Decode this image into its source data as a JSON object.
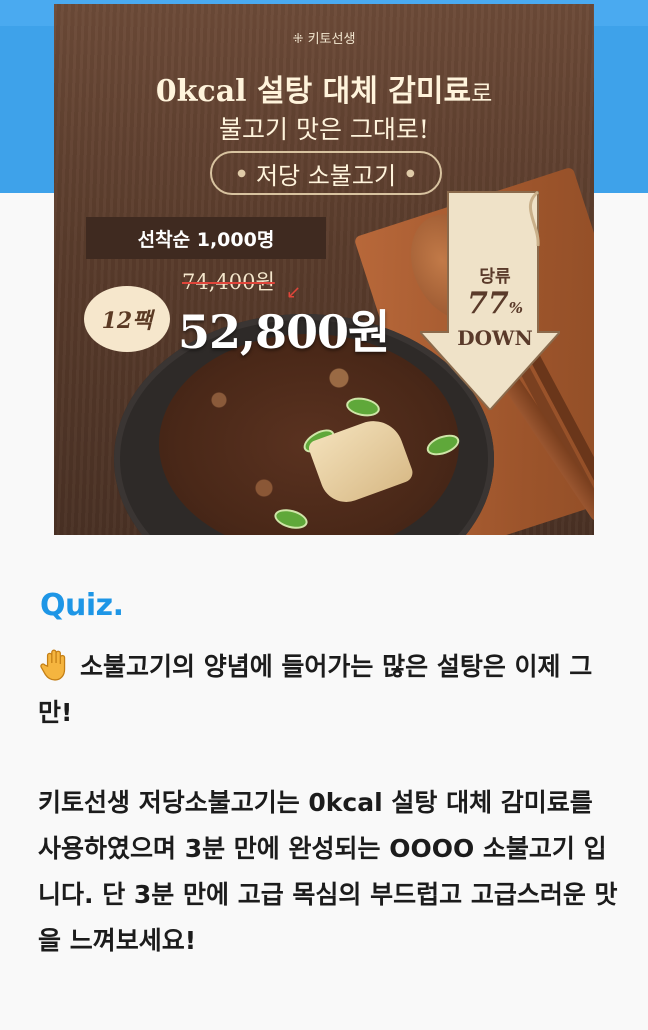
{
  "colors": {
    "accent_blue": "#3ea2ea",
    "quiz_title": "#1e96e6",
    "body_text": "#1c1c1c",
    "banner_brown": "#5a3c2c"
  },
  "banner": {
    "brand": "키토선생",
    "headline_main": "0kcal 설탕 대체 감미료",
    "headline_suffix": "로",
    "subline": "불고기 맛은 그대로!",
    "product_name": "저당 소불고기",
    "first_come": "선착순 1,000명",
    "pack_count": "12팩",
    "original_price": "74,400원",
    "sale_price": "52,800원",
    "sugar_label": "당류",
    "sugar_percent": "77",
    "percent_sign": "%",
    "down_label": "DOWN"
  },
  "quiz": {
    "title": "Quiz.",
    "hand_icon": "raised-hand-icon",
    "paragraph1": "소불고기의 양념에 들어가는 많은 설탕은 이제 그만!",
    "paragraph2": "키토선생 저당소불고기는 0kcal 설탕 대체 감미료를 사용하였으며 3분 만에 완성되는 OOOO 소불고기 입니다. 단 3분 만에 고급 목심의 부드럽고 고급스러운 맛을 느껴보세요!"
  }
}
